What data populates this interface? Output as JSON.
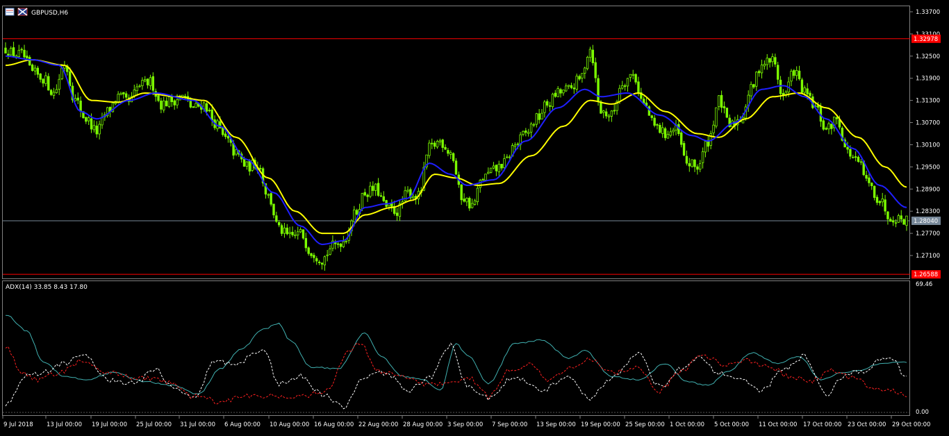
{
  "window": {
    "symbol_title": "GBPUSD,H6",
    "indicator_title": "ADX(14) 33.85 8.43 17.80"
  },
  "colors": {
    "background": "#000000",
    "bull_candle": "#7cfc00",
    "bear_candle": "#7cfc00",
    "ma_fast": "#1f1fff",
    "ma_slow": "#ffff00",
    "level_line": "#ff0000",
    "bid_line": "#778899",
    "adx_main": "#40b0b0",
    "plus_di": "#ffffff",
    "minus_di": "#ff2020",
    "axis_text": "#ffffff",
    "frame": "#808080"
  },
  "chart_data": [
    {
      "type": "candlestick",
      "name": "GBPUSD,H6",
      "ylim": [
        1.2648,
        1.3385
      ],
      "price_ticks": [
        "1.33700",
        "1.33100",
        "1.32500",
        "1.31900",
        "1.31300",
        "1.30700",
        "1.30100",
        "1.29500",
        "1.28900",
        "1.28300",
        "1.27700",
        "1.27100"
      ],
      "x_labels": [
        "9 Jul 2018",
        "13 Jul 00:00",
        "19 Jul 00:00",
        "25 Jul 00:00",
        "31 Jul 00:00",
        "6 Aug 00:00",
        "10 Aug 00:00",
        "16 Aug 00:00",
        "22 Aug 00:00",
        "28 Aug 00:00",
        "3 Sep 00:00",
        "7 Sep 00:00",
        "13 Sep 00:00",
        "19 Sep 00:00",
        "25 Sep 00:00",
        "1 Oct 00:00",
        "5 Oct 00:00",
        "11 Oct 00:00",
        "17 Oct 00:00",
        "23 Oct 00:00",
        "29 Oct 00:00"
      ],
      "levels": [
        {
          "value": 1.3297,
          "label": "1.32978",
          "kind": "resistance"
        },
        {
          "value": 1.2659,
          "label": "1.26588",
          "kind": "support"
        }
      ],
      "current_price": {
        "value": 1.2804,
        "label": "1.28040"
      },
      "price_anchors": [
        [
          0,
          1.327
        ],
        [
          3,
          1.3255
        ],
        [
          6,
          1.3255
        ],
        [
          10,
          1.3205
        ],
        [
          14,
          1.319
        ],
        [
          18,
          1.315
        ],
        [
          22,
          1.323
        ],
        [
          26,
          1.313
        ],
        [
          30,
          1.308
        ],
        [
          34,
          1.3045
        ],
        [
          38,
          1.31
        ],
        [
          42,
          1.314
        ],
        [
          46,
          1.3125
        ],
        [
          50,
          1.317
        ],
        [
          54,
          1.318
        ],
        [
          58,
          1.312
        ],
        [
          62,
          1.313
        ],
        [
          66,
          1.314
        ],
        [
          70,
          1.311
        ],
        [
          74,
          1.312
        ],
        [
          78,
          1.307
        ],
        [
          82,
          1.3025
        ],
        [
          86,
          1.2985
        ],
        [
          90,
          1.295
        ],
        [
          94,
          1.296
        ],
        [
          98,
          1.287
        ],
        [
          102,
          1.278
        ],
        [
          106,
          1.276
        ],
        [
          110,
          1.277
        ],
        [
          114,
          1.272
        ],
        [
          118,
          1.27
        ],
        [
          122,
          1.2735
        ],
        [
          126,
          1.275
        ],
        [
          130,
          1.282
        ],
        [
          134,
          1.288
        ],
        [
          138,
          1.289
        ],
        [
          142,
          1.284
        ],
        [
          146,
          1.283
        ],
        [
          150,
          1.288
        ],
        [
          154,
          1.287
        ],
        [
          158,
          1.3
        ],
        [
          162,
          1.302
        ],
        [
          166,
          1.299
        ],
        [
          170,
          1.287
        ],
        [
          174,
          1.2845
        ],
        [
          178,
          1.292
        ],
        [
          182,
          1.294
        ],
        [
          186,
          1.296
        ],
        [
          190,
          1.301
        ],
        [
          194,
          1.304
        ],
        [
          198,
          1.308
        ],
        [
          202,
          1.312
        ],
        [
          206,
          1.315
        ],
        [
          210,
          1.316
        ],
        [
          214,
          1.3185
        ],
        [
          218,
          1.327
        ],
        [
          222,
          1.31
        ],
        [
          226,
          1.309
        ],
        [
          230,
          1.318
        ],
        [
          234,
          1.32
        ],
        [
          238,
          1.312
        ],
        [
          242,
          1.306
        ],
        [
          246,
          1.304
        ],
        [
          250,
          1.305
        ],
        [
          254,
          1.296
        ],
        [
          258,
          1.295
        ],
        [
          262,
          1.302
        ],
        [
          266,
          1.313
        ],
        [
          270,
          1.306
        ],
        [
          274,
          1.308
        ],
        [
          278,
          1.316
        ],
        [
          282,
          1.323
        ],
        [
          286,
          1.324
        ],
        [
          290,
          1.314
        ],
        [
          294,
          1.321
        ],
        [
          298,
          1.315
        ],
        [
          302,
          1.311
        ],
        [
          306,
          1.305
        ],
        [
          310,
          1.308
        ],
        [
          314,
          1.299
        ],
        [
          318,
          1.296
        ],
        [
          322,
          1.29
        ],
        [
          326,
          1.286
        ],
        [
          330,
          1.2815
        ],
        [
          334,
          1.281
        ],
        [
          336,
          1.2806
        ]
      ],
      "ma_fast_anchors": [
        [
          0,
          1.325
        ],
        [
          10,
          1.324
        ],
        [
          20,
          1.3225
        ],
        [
          28,
          1.31
        ],
        [
          34,
          1.308
        ],
        [
          46,
          1.313
        ],
        [
          56,
          1.315
        ],
        [
          70,
          1.313
        ],
        [
          80,
          1.306
        ],
        [
          90,
          1.297
        ],
        [
          100,
          1.288
        ],
        [
          110,
          1.279
        ],
        [
          118,
          1.274
        ],
        [
          126,
          1.275
        ],
        [
          134,
          1.284
        ],
        [
          142,
          1.285
        ],
        [
          150,
          1.2865
        ],
        [
          158,
          1.296
        ],
        [
          166,
          1.293
        ],
        [
          172,
          1.29
        ],
        [
          182,
          1.2915
        ],
        [
          194,
          1.302
        ],
        [
          206,
          1.311
        ],
        [
          216,
          1.316
        ],
        [
          222,
          1.314
        ],
        [
          232,
          1.315
        ],
        [
          244,
          1.309
        ],
        [
          256,
          1.3035
        ],
        [
          262,
          1.302
        ],
        [
          272,
          1.307
        ],
        [
          282,
          1.316
        ],
        [
          290,
          1.317
        ],
        [
          298,
          1.314
        ],
        [
          306,
          1.308
        ],
        [
          316,
          1.3
        ],
        [
          326,
          1.29
        ],
        [
          336,
          1.284
        ]
      ],
      "ma_slow_anchors": [
        [
          0,
          1.3225
        ],
        [
          10,
          1.324
        ],
        [
          22,
          1.3225
        ],
        [
          32,
          1.313
        ],
        [
          42,
          1.3125
        ],
        [
          52,
          1.315
        ],
        [
          64,
          1.314
        ],
        [
          74,
          1.313
        ],
        [
          86,
          1.303
        ],
        [
          98,
          1.292
        ],
        [
          108,
          1.283
        ],
        [
          118,
          1.277
        ],
        [
          126,
          1.277
        ],
        [
          134,
          1.282
        ],
        [
          144,
          1.284
        ],
        [
          152,
          1.286
        ],
        [
          160,
          1.293
        ],
        [
          168,
          1.292
        ],
        [
          176,
          1.29
        ],
        [
          184,
          1.2905
        ],
        [
          196,
          1.298
        ],
        [
          208,
          1.306
        ],
        [
          218,
          1.313
        ],
        [
          226,
          1.312
        ],
        [
          236,
          1.315
        ],
        [
          246,
          1.31
        ],
        [
          258,
          1.304
        ],
        [
          266,
          1.303
        ],
        [
          276,
          1.308
        ],
        [
          286,
          1.314
        ],
        [
          296,
          1.315
        ],
        [
          306,
          1.311
        ],
        [
          318,
          1.303
        ],
        [
          328,
          1.295
        ],
        [
          336,
          1.2895
        ]
      ],
      "bar_count": 337
    },
    {
      "type": "line",
      "name": "ADX(14) 33.85 8.43 17.80",
      "ylim": [
        0,
        69.46
      ],
      "ticks": [
        "69.46",
        "0.00"
      ],
      "series": [
        {
          "name": "ADX",
          "color": "#40b0b0",
          "style": "solid",
          "anchors": [
            [
              0,
              54
            ],
            [
              8,
              45
            ],
            [
              14,
              28
            ],
            [
              22,
              20
            ],
            [
              30,
              18
            ],
            [
              40,
              22
            ],
            [
              52,
              17
            ],
            [
              62,
              15
            ],
            [
              72,
              10
            ],
            [
              80,
              24
            ],
            [
              88,
              35
            ],
            [
              96,
              46
            ],
            [
              102,
              49
            ],
            [
              106,
              40
            ],
            [
              114,
              25
            ],
            [
              124,
              24
            ],
            [
              134,
              44
            ],
            [
              140,
              31
            ],
            [
              148,
              20
            ],
            [
              156,
              18
            ],
            [
              162,
              12
            ],
            [
              168,
              38
            ],
            [
              172,
              32
            ],
            [
              180,
              16
            ],
            [
              190,
              38
            ],
            [
              200,
              40
            ],
            [
              210,
              30
            ],
            [
              216,
              34
            ],
            [
              226,
              20
            ],
            [
              236,
              18
            ],
            [
              246,
              27
            ],
            [
              254,
              17
            ],
            [
              262,
              15
            ],
            [
              270,
              23
            ],
            [
              278,
              33
            ],
            [
              288,
              27
            ],
            [
              296,
              31
            ],
            [
              304,
              18
            ],
            [
              312,
              22
            ],
            [
              318,
              23
            ],
            [
              326,
              27
            ],
            [
              336,
              28
            ]
          ]
        },
        {
          "name": "+DI",
          "color": "#ffffff",
          "style": "dashed",
          "anchors": [
            [
              0,
              5
            ],
            [
              8,
              20
            ],
            [
              14,
              22
            ],
            [
              22,
              27
            ],
            [
              30,
              32
            ],
            [
              38,
              18
            ],
            [
              48,
              16
            ],
            [
              56,
              24
            ],
            [
              62,
              14
            ],
            [
              70,
              8
            ],
            [
              78,
              28
            ],
            [
              86,
              27
            ],
            [
              96,
              35
            ],
            [
              102,
              16
            ],
            [
              110,
              20
            ],
            [
              118,
              10
            ],
            [
              126,
              3
            ],
            [
              134,
              20
            ],
            [
              142,
              22
            ],
            [
              150,
              12
            ],
            [
              158,
              19
            ],
            [
              166,
              37
            ],
            [
              172,
              15
            ],
            [
              180,
              8
            ],
            [
              190,
              20
            ],
            [
              200,
              12
            ],
            [
              210,
              20
            ],
            [
              218,
              8
            ],
            [
              226,
              19
            ],
            [
              236,
              32
            ],
            [
              244,
              14
            ],
            [
              252,
              24
            ],
            [
              258,
              30
            ],
            [
              266,
              22
            ],
            [
              274,
              18
            ],
            [
              282,
              12
            ],
            [
              290,
              24
            ],
            [
              298,
              31
            ],
            [
              306,
              10
            ],
            [
              312,
              20
            ],
            [
              320,
              23
            ],
            [
              326,
              29
            ],
            [
              330,
              30
            ],
            [
              336,
              20
            ]
          ]
        },
        {
          "name": "-DI",
          "color": "#ff2020",
          "style": "dashed",
          "anchors": [
            [
              0,
              37
            ],
            [
              6,
              22
            ],
            [
              12,
              18
            ],
            [
              20,
              22
            ],
            [
              28,
              28
            ],
            [
              38,
              22
            ],
            [
              50,
              19
            ],
            [
              60,
              17
            ],
            [
              70,
              9
            ],
            [
              80,
              6
            ],
            [
              90,
              9
            ],
            [
              100,
              9
            ],
            [
              110,
              9
            ],
            [
              120,
              12
            ],
            [
              128,
              34
            ],
            [
              132,
              38
            ],
            [
              140,
              22
            ],
            [
              150,
              20
            ],
            [
              158,
              15
            ],
            [
              166,
              16
            ],
            [
              172,
              20
            ],
            [
              180,
              9
            ],
            [
              188,
              23
            ],
            [
              196,
              26
            ],
            [
              202,
              18
            ],
            [
              210,
              24
            ],
            [
              218,
              30
            ],
            [
              226,
              22
            ],
            [
              236,
              25
            ],
            [
              244,
              12
            ],
            [
              252,
              23
            ],
            [
              260,
              32
            ],
            [
              268,
              26
            ],
            [
              276,
              29
            ],
            [
              284,
              26
            ],
            [
              292,
              20
            ],
            [
              300,
              17
            ],
            [
              308,
              23
            ],
            [
              316,
              19
            ],
            [
              324,
              14
            ],
            [
              330,
              12
            ],
            [
              336,
              10
            ]
          ]
        }
      ]
    }
  ]
}
